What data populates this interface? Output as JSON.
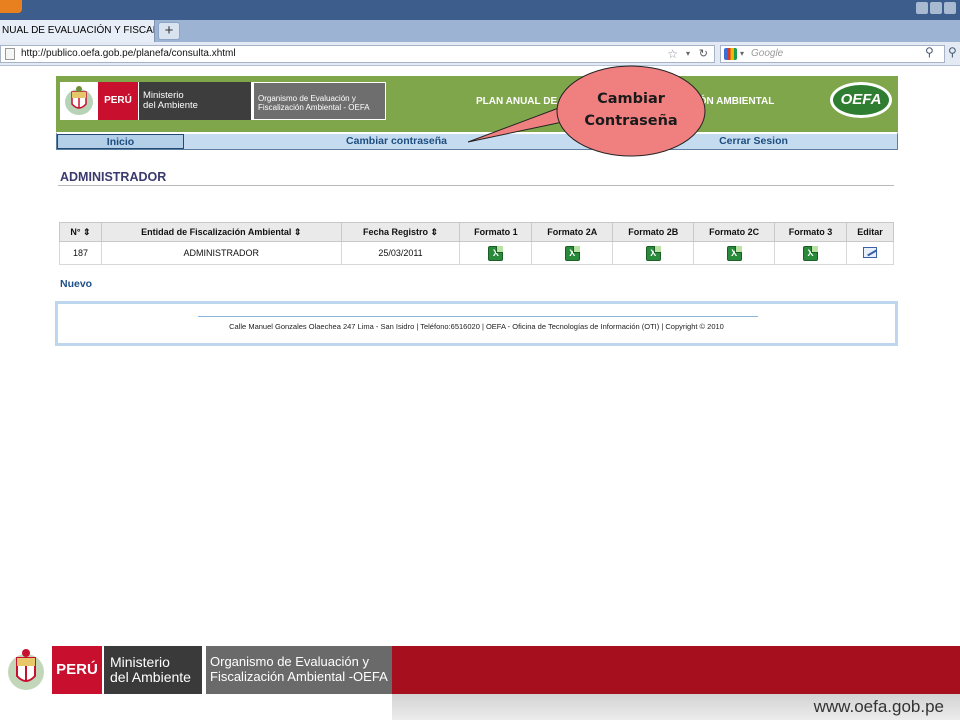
{
  "browser": {
    "tab_title": "NUAL DE EVALUACIÓN Y FISCAL...",
    "tab_new": "+",
    "url": "http://publico.oefa.gob.pe/planefa/consulta.xhtml",
    "search_placeholder": "Google"
  },
  "header": {
    "peru": "PERÚ",
    "ministerio": "Ministerio\ndel Ambiente",
    "organismo": "Organismo de Evaluación y Fiscalización Ambiental - OEFA",
    "plan_title_left": "PLAN ANUAL DE",
    "plan_title_right": "IÓN AMBIENTAL",
    "oefa_logo": "OEFA"
  },
  "menu": {
    "inicio": "Inicio",
    "cambiar": "Cambiar contraseña",
    "cerrar": "Cerrar Sesion"
  },
  "callout": {
    "line1": "Cambiar",
    "line2": "Contraseña",
    "color": "#f08080"
  },
  "section": {
    "title": "ADMINISTRADOR"
  },
  "table": {
    "headers": [
      "N° ⇕",
      "Entidad de Fiscalización Ambiental ⇕",
      "Fecha Registro ⇕",
      "Formato 1",
      "Formato 2A",
      "Formato 2B",
      "Formato 2C",
      "Formato 3",
      "Editar"
    ],
    "rows": [
      {
        "num": "187",
        "entidad": "ADMINISTRADOR",
        "fecha": "25/03/2011"
      }
    ]
  },
  "actions": {
    "nuevo": "Nuevo"
  },
  "footer": {
    "text": "Calle Manuel Gonzales Olaechea 247 Lima - San Isidro | Teléfono:6516020 | OEFA - Oficina de Tecnologías de Información (OTI) | Copyright © 2010"
  },
  "banner": {
    "peru": "PERÚ",
    "ministerio_1": "Ministerio",
    "ministerio_2": "del Ambiente",
    "organismo_1": "Organismo de Evaluación y",
    "organismo_2": "Fiscalización Ambiental -OEFA",
    "url": "www.oefa.gob.pe"
  },
  "colors": {
    "header_green": "#7fa64b",
    "menu_blue": "#c5dcf0",
    "banner_red": "#a50f1e",
    "peru_red": "#c8102e"
  }
}
